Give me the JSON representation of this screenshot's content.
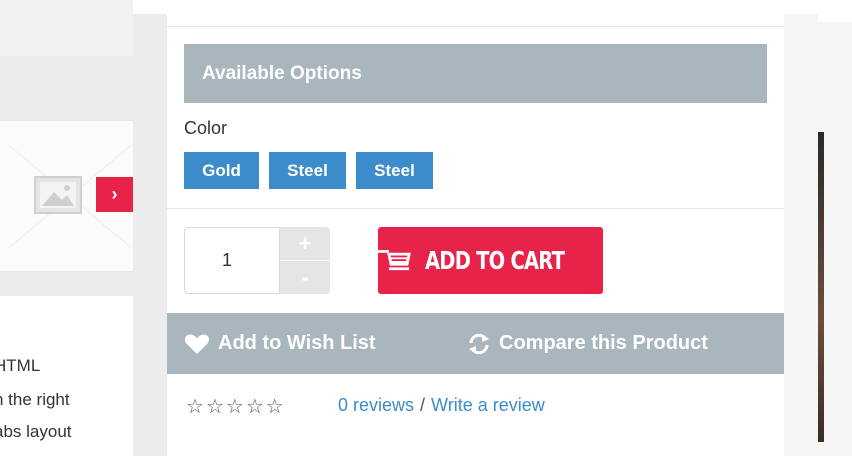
{
  "gallery": {
    "next_arrow": "›"
  },
  "description": {
    "lines": [
      "HTML",
      "n the right",
      "abs layout"
    ]
  },
  "options": {
    "header": "Available Options",
    "color_label": "Color",
    "colors": [
      "Gold",
      "Steel",
      "Steel"
    ],
    "swatch_color": "#3c8ccb"
  },
  "quantity": {
    "value": "1",
    "plus": "+",
    "minus": "-"
  },
  "cart": {
    "label": "ADD TO CART",
    "icon": "cart-icon",
    "color": "#e8234a"
  },
  "actions": {
    "wishlist_label": "Add to Wish List",
    "wishlist_icon": "heart-icon",
    "compare_label": "Compare this Product",
    "compare_icon": "refresh-icon",
    "bar_color": "#a9b6be"
  },
  "reviews": {
    "stars": [
      "☆",
      "☆",
      "☆",
      "☆",
      "☆"
    ],
    "count_label": "0 reviews",
    "separator": "/",
    "write_label": "Write a review"
  }
}
